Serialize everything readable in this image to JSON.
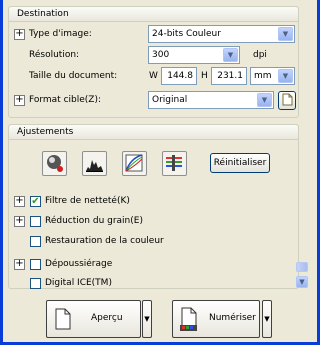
{
  "destination": {
    "header": "Destination",
    "image_type_label": "Type d'image:",
    "image_type_value": "24-bits Couleur",
    "resolution_label": "Résolution:",
    "resolution_value": "300",
    "resolution_unit": "dpi",
    "doc_size_label": "Taille du document:",
    "width_label": "W",
    "width_value": "144.8",
    "height_label": "H",
    "height_value": "231.1",
    "size_unit": "mm",
    "target_format_label": "Format cible(Z):",
    "target_format_value": "Original"
  },
  "adjustments": {
    "header": "Ajustements",
    "reset_label": "Réinitialiser",
    "sharpness_label": "Filtre de netteté(K)",
    "sharpness_checked": true,
    "grain_label": "Réduction du grain(E)",
    "grain_checked": false,
    "color_restore_label": "Restauration de la couleur",
    "color_restore_checked": false,
    "descreen_label": "Dépoussiérage",
    "descreen_checked": false,
    "digital_ice_label": "Digital ICE(TM)",
    "digital_ice_checked": false
  },
  "actions": {
    "preview_label": "Aperçu",
    "scan_label": "Numériser"
  }
}
